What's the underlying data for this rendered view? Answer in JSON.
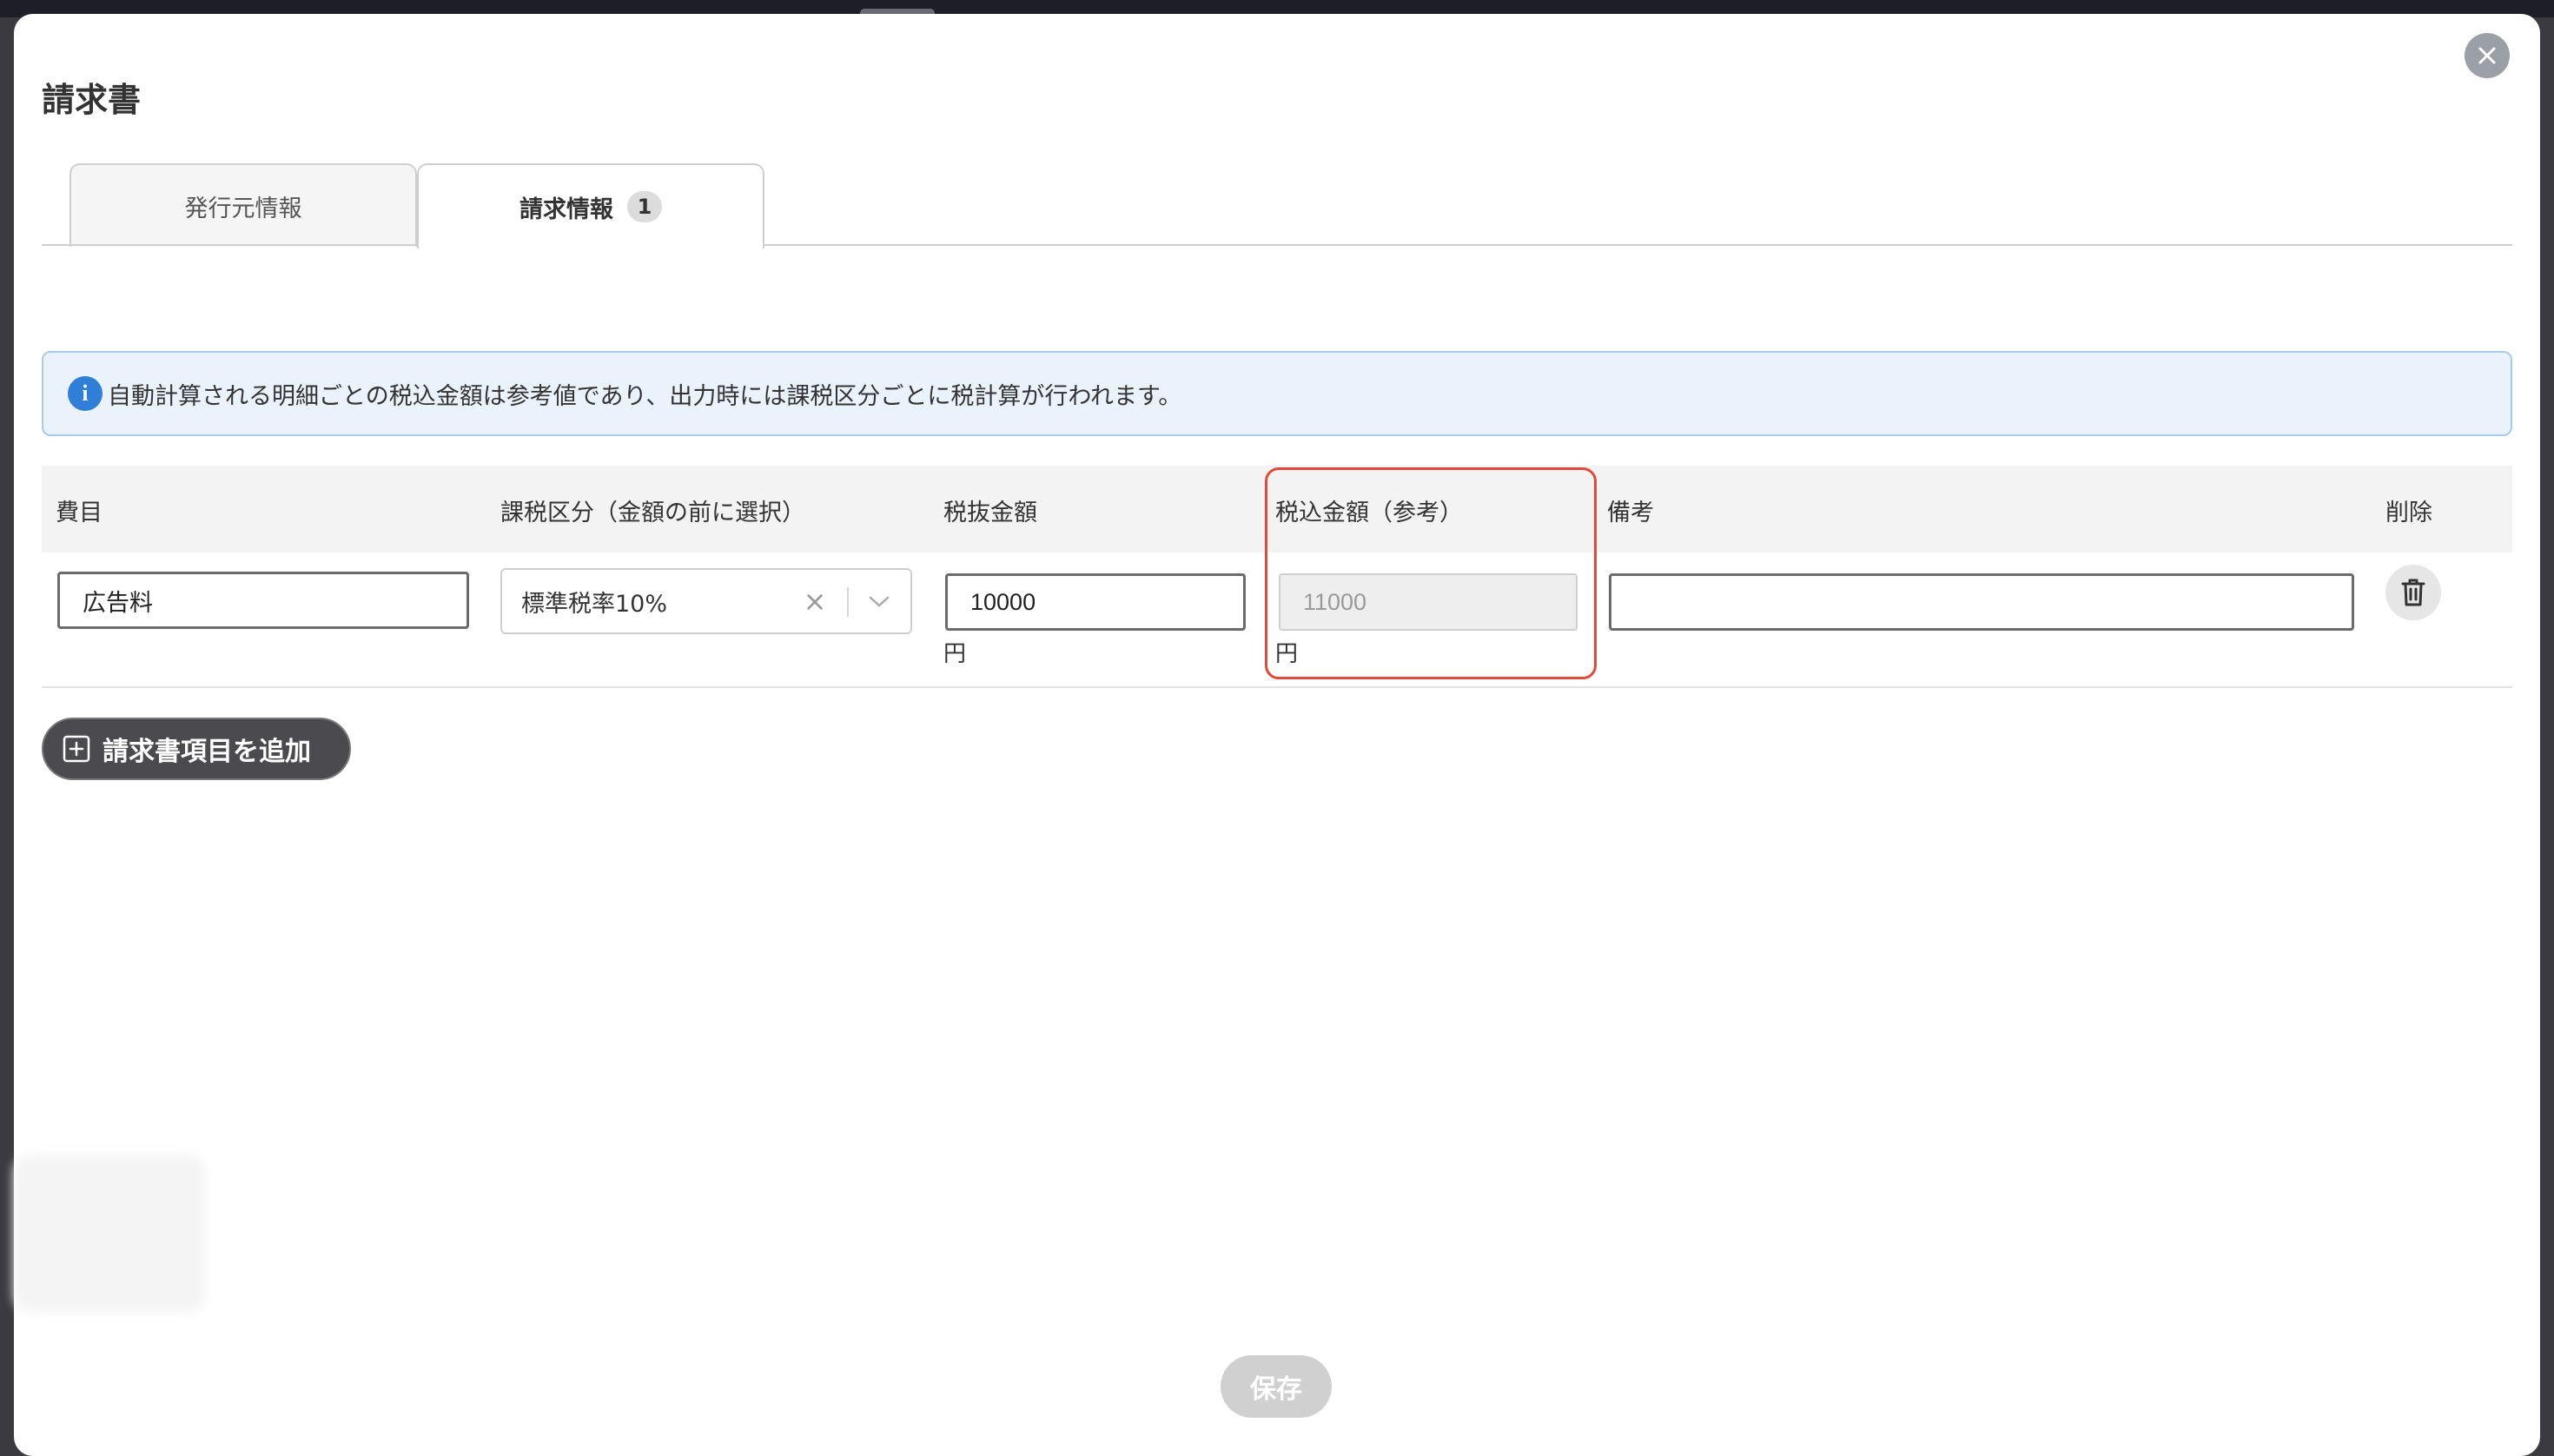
{
  "modal": {
    "title": "請求書",
    "close_icon": "close-icon"
  },
  "tabs": [
    {
      "label": "発行元情報",
      "active": false
    },
    {
      "label": "請求情報",
      "active": true,
      "badge": "1"
    }
  ],
  "info": {
    "icon": "info-icon",
    "message": "自動計算される明細ごとの税込金額は参考値であり、出力時には課税区分ごとに税計算が行われます。"
  },
  "table": {
    "headers": {
      "item": "費目",
      "tax_category": "課税区分（金額の前に選択）",
      "amount_excl": "税抜金額",
      "amount_incl": "税込金額（参考）",
      "notes": "備考",
      "delete": "削除"
    },
    "rows": [
      {
        "item": "広告料",
        "tax_category": "標準税率10%",
        "amount_excl": "10000",
        "amount_excl_unit": "円",
        "amount_incl": "11000",
        "amount_incl_unit": "円",
        "notes": ""
      }
    ]
  },
  "actions": {
    "add_item": "請求書項目を追加",
    "save": "保存"
  },
  "colors": {
    "highlight": "#e04a3a",
    "info_bg": "#eaf3fc",
    "info_icon": "#2f7fd8",
    "add_button": "#4a4a4f",
    "save_button_disabled": "#d0d0d0"
  }
}
